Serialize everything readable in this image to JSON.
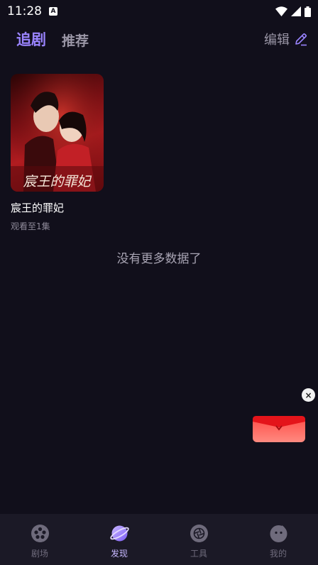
{
  "status_bar": {
    "time": "11:28",
    "notification_badge": "A"
  },
  "header": {
    "tab_following": "追剧",
    "tab_recommend": "推荐",
    "edit_label": "编辑"
  },
  "items": [
    {
      "title": "宸王的罪妃",
      "progress": "观看至1集",
      "poster_caption": "宸王的罪妃"
    }
  ],
  "empty_message": "没有更多数据了",
  "close_glyph": "×",
  "bottom_nav": [
    {
      "label": "剧场",
      "icon": "film-reel-icon",
      "active": false
    },
    {
      "label": "发现",
      "icon": "planet-icon",
      "active": true
    },
    {
      "label": "工具",
      "icon": "aperture-icon",
      "active": false
    },
    {
      "label": "我的",
      "icon": "profile-face-icon",
      "active": false
    }
  ],
  "colors": {
    "accent": "#9a84ff",
    "background": "#110f1b",
    "nav_bg": "#1b1926"
  }
}
